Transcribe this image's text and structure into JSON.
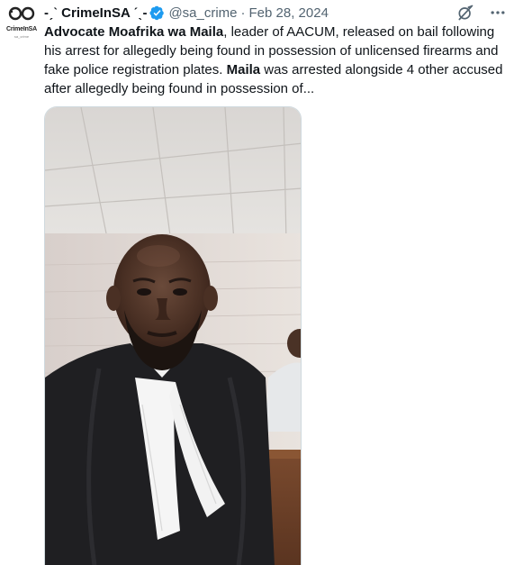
{
  "account": {
    "display_name": "-ˏˋ CrimeInSA ˊˎ-",
    "handle": "@sa_crime",
    "separator": "·",
    "date": "Feb 28, 2024",
    "avatar_text": "CrimeInSA",
    "avatar_subtext": "sa_crime",
    "verified_color": "#1d9bf0"
  },
  "post": {
    "bold_1": "Advocate Moafrika wa Maila",
    "text_1": ", leader of AACUM, released on bail following his arrest for allegedly being found in possession of unlicensed firearms and fake police registration plates. ",
    "bold_2": "Maila",
    "text_2": " was arrested alongside 4 other accused after allegedly being found in possession of..."
  },
  "icons": {
    "grok": "grok-icon",
    "more": "more-icon",
    "verified": "verified-badge-icon",
    "avatar": "handcuffs-icon"
  },
  "colors": {
    "text_primary": "#0f1419",
    "text_secondary": "#536471",
    "border": "#cfd9de"
  }
}
